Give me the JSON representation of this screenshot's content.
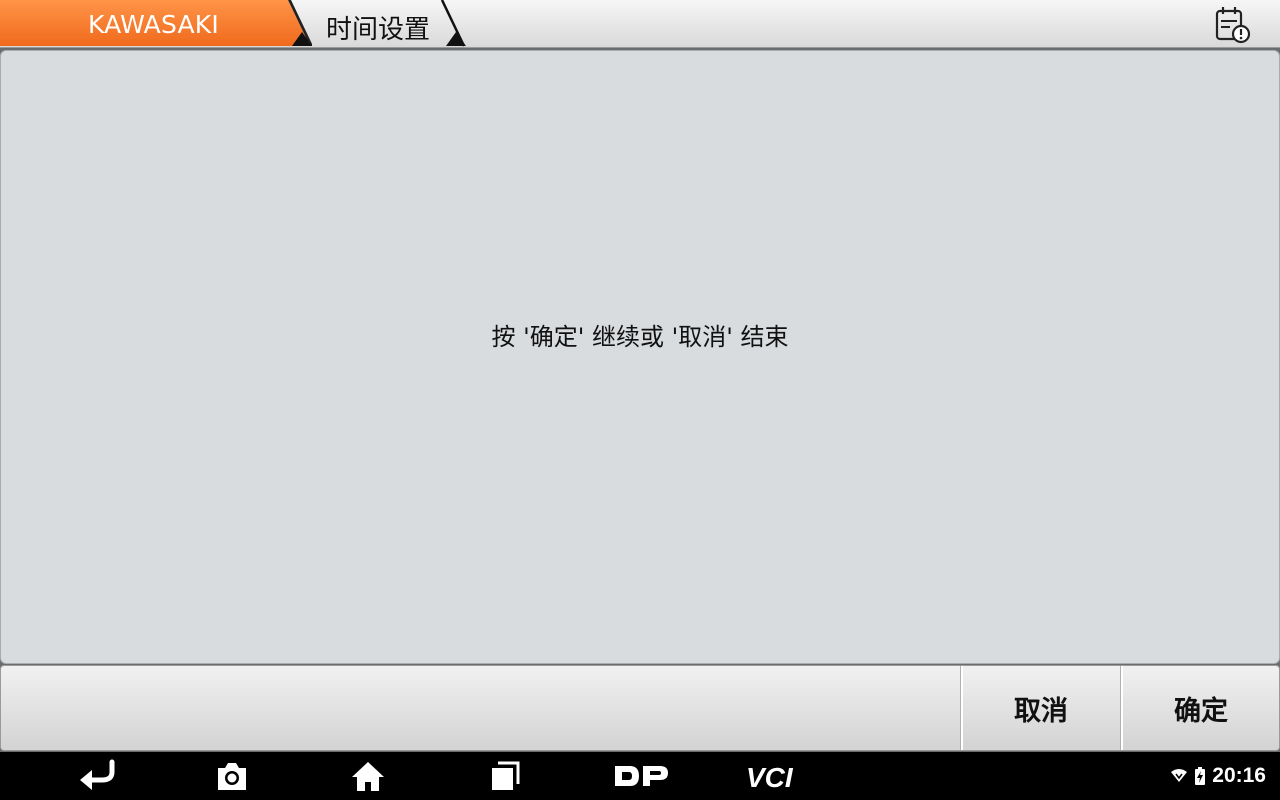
{
  "header": {
    "brand": "KAWASAKI",
    "current_page": "时间设置",
    "accent_color": "#f47a2c",
    "report_icon": "report-alert-icon"
  },
  "main": {
    "message": "按 '确定' 继续或 '取消' 结束"
  },
  "buttons": {
    "cancel": "取消",
    "ok": "确定"
  },
  "navbar": {
    "icons": [
      "back-icon",
      "camera-icon",
      "home-icon",
      "recent-apps-icon",
      "dp-logo",
      "vci-logo"
    ],
    "dp_label": "DP",
    "vci_label": "VCI",
    "time": "20:16"
  }
}
